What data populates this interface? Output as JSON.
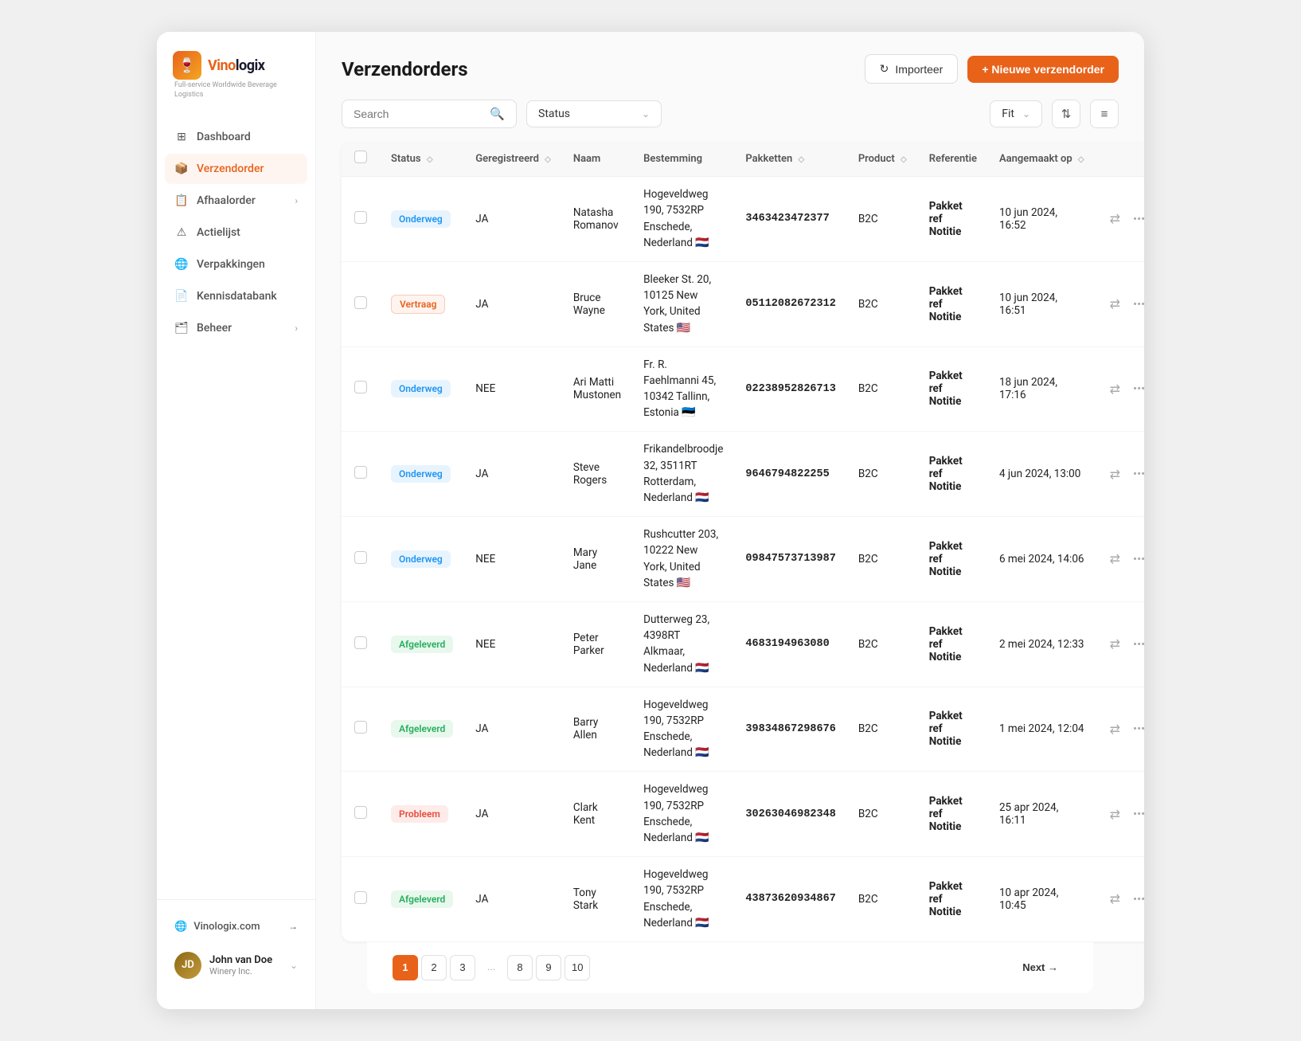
{
  "app": {
    "logo_text": "Vinologix",
    "logo_subtitle": "Full-service Worldwide Beverage Logistics",
    "logo_emoji": "🍷"
  },
  "sidebar": {
    "items": [
      {
        "id": "dashboard",
        "label": "Dashboard",
        "icon": "⊞",
        "active": false,
        "has_chevron": false
      },
      {
        "id": "verzendorder",
        "label": "Verzendorder",
        "icon": "📦",
        "active": true,
        "has_chevron": false
      },
      {
        "id": "afhaalorder",
        "label": "Afhaalorder",
        "icon": "📋",
        "active": false,
        "has_chevron": true
      },
      {
        "id": "actielijst",
        "label": "Actielijst",
        "icon": "⚠",
        "active": false,
        "has_chevron": false
      },
      {
        "id": "verpakkingen",
        "label": "Verpakkingen",
        "icon": "🌐",
        "active": false,
        "has_chevron": false
      },
      {
        "id": "kennisdatabank",
        "label": "Kennisdatabank",
        "icon": "📄",
        "active": false,
        "has_chevron": false
      },
      {
        "id": "beheer",
        "label": "Beheer",
        "icon": "🗂",
        "active": false,
        "has_chevron": true
      }
    ],
    "link": {
      "label": "Vinologix.com",
      "icon": "🌐",
      "arrow": "→"
    },
    "user": {
      "name": "John van Doe",
      "company": "Winery Inc.",
      "initials": "JD"
    }
  },
  "header": {
    "title": "Verzendorders",
    "import_label": "Importeer",
    "new_label": "+ Nieuwe verzendorder"
  },
  "toolbar": {
    "search_placeholder": "Search",
    "status_label": "Status",
    "fit_label": "Fit"
  },
  "table": {
    "columns": [
      {
        "id": "checkbox",
        "label": ""
      },
      {
        "id": "status",
        "label": "Status",
        "sortable": true
      },
      {
        "id": "geregistreerd",
        "label": "Geregistreerd",
        "sortable": true
      },
      {
        "id": "naam",
        "label": "Naam",
        "sortable": false
      },
      {
        "id": "bestemming",
        "label": "Bestemming",
        "sortable": false
      },
      {
        "id": "pakketten",
        "label": "Pakketten",
        "sortable": true
      },
      {
        "id": "product",
        "label": "Product",
        "sortable": true
      },
      {
        "id": "referentie",
        "label": "Referentie",
        "sortable": false
      },
      {
        "id": "aangemaakt",
        "label": "Aangemaakt op",
        "sortable": true
      },
      {
        "id": "actions",
        "label": ""
      }
    ],
    "rows": [
      {
        "status": "Onderweg",
        "status_class": "status-onderweg",
        "geregistreerd": "JA",
        "naam": "Natasha Romanov",
        "bestemming": "Hogeveldweg 190, 7532RP Enschede, Nederland",
        "dest_flag": "🇳🇱",
        "pakketten": "3463423472377",
        "product": "B2C",
        "referentie": "Pakket ref Notitie",
        "aangemaakt": "10 jun 2024, 16:52"
      },
      {
        "status": "Vertraag",
        "status_class": "status-vertraag",
        "geregistreerd": "JA",
        "naam": "Bruce Wayne",
        "bestemming": "Bleeker St. 20, 10125 New York, United States",
        "dest_flag": "🇺🇸",
        "pakketten": "05112082672312",
        "product": "B2C",
        "referentie": "Pakket ref Notitie",
        "aangemaakt": "10 jun 2024, 16:51"
      },
      {
        "status": "Onderweg",
        "status_class": "status-onderweg",
        "geregistreerd": "NEE",
        "naam": "Ari Matti Mustonen",
        "bestemming": "Fr. R. Faehlmanni 45, 10342 Tallinn, Estonia",
        "dest_flag": "🇪🇪",
        "pakketten": "02238952826713",
        "product": "B2C",
        "referentie": "Pakket ref Notitie",
        "aangemaakt": "18 jun 2024, 17:16"
      },
      {
        "status": "Onderweg",
        "status_class": "status-onderweg",
        "geregistreerd": "JA",
        "naam": "Steve Rogers",
        "bestemming": "Frikandelbroodje 32, 3511RT Rotterdam, Nederland",
        "dest_flag": "🇳🇱",
        "pakketten": "9646794822255",
        "product": "B2C",
        "referentie": "Pakket ref Notitie",
        "aangemaakt": "4 jun 2024, 13:00"
      },
      {
        "status": "Onderweg",
        "status_class": "status-onderweg",
        "geregistreerd": "NEE",
        "naam": "Mary Jane",
        "bestemming": "Rushcutter 203, 10222 New York, United States",
        "dest_flag": "🇺🇸",
        "pakketten": "09847573713987",
        "product": "B2C",
        "referentie": "Pakket ref Notitie",
        "aangemaakt": "6 mei 2024, 14:06"
      },
      {
        "status": "Afgeleverd",
        "status_class": "status-afgeleverd",
        "geregistreerd": "NEE",
        "naam": "Peter Parker",
        "bestemming": "Dutterweg 23, 4398RT Alkmaar, Nederland",
        "dest_flag": "🇳🇱",
        "pakketten": "4683194963080",
        "product": "B2C",
        "referentie": "Pakket ref Notitie",
        "aangemaakt": "2 mei 2024, 12:33"
      },
      {
        "status": "Afgeleverd",
        "status_class": "status-afgeleverd",
        "geregistreerd": "JA",
        "naam": "Barry Allen",
        "bestemming": "Hogeveldweg 190, 7532RP Enschede, Nederland",
        "dest_flag": "🇳🇱",
        "pakketten": "39834867298676",
        "product": "B2C",
        "referentie": "Pakket ref Notitie",
        "aangemaakt": "1 mei 2024, 12:04"
      },
      {
        "status": "Probleem",
        "status_class": "status-probleem",
        "geregistreerd": "JA",
        "naam": "Clark Kent",
        "bestemming": "Hogeveldweg 190, 7532RP Enschede, Nederland",
        "dest_flag": "🇳🇱",
        "pakketten": "30263046982348",
        "product": "B2C",
        "referentie": "Pakket ref Notitie",
        "aangemaakt": "25 apr 2024, 16:11"
      },
      {
        "status": "Afgeleverd",
        "status_class": "status-afgeleverd",
        "geregistreerd": "JA",
        "naam": "Tony Stark",
        "bestemming": "Hogeveldweg 190, 7532RP Enschede, Nederland",
        "dest_flag": "🇳🇱",
        "pakketten": "43873620934867",
        "product": "B2C",
        "referentie": "Pakket ref Notitie",
        "aangemaakt": "10 apr 2024, 10:45"
      }
    ]
  },
  "pagination": {
    "pages": [
      1,
      2,
      3,
      8,
      9,
      10
    ],
    "current": 1,
    "ellipsis": "...",
    "next_label": "Next →"
  }
}
